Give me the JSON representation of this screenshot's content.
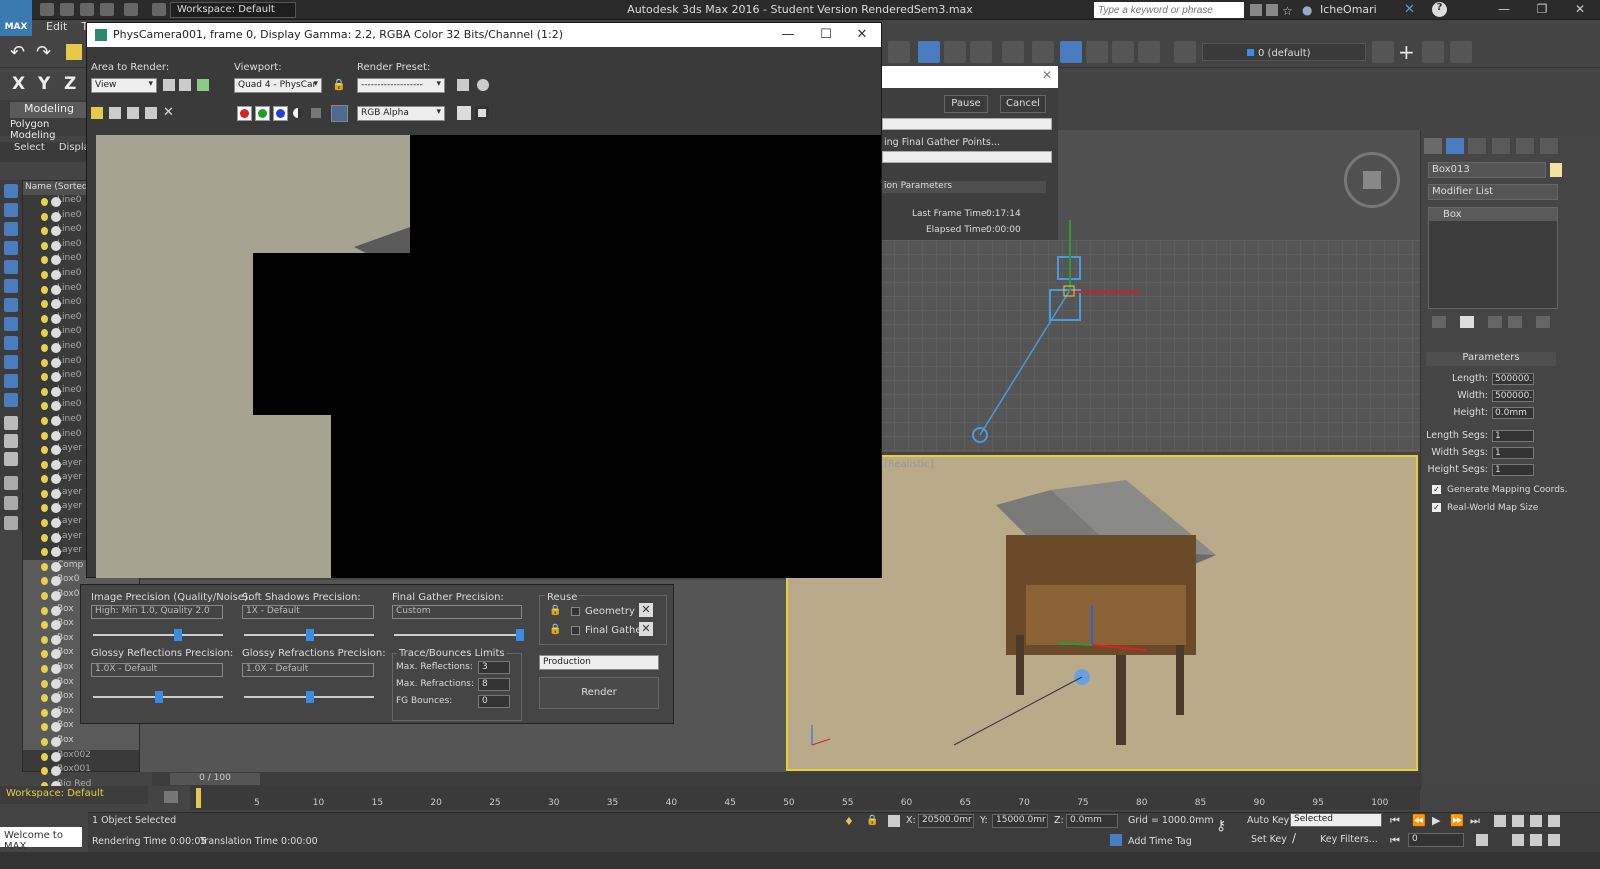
{
  "titlebar": {
    "workspace": "Workspace: Default",
    "app_title": "Autodesk 3ds Max 2016 - Student Version      RenderedSem3.max",
    "search_placeholder": "Type a keyword or phrase",
    "user": "IcheOmari"
  },
  "menubar": {
    "edit": "Edit",
    "t": "T"
  },
  "axes": [
    "X",
    "Y",
    "Z"
  ],
  "ribbon": {
    "tab": "Modeling",
    "sub": "Polygon Modeling"
  },
  "scene_tabs": [
    "Select",
    "Display"
  ],
  "explorer": {
    "header": "Name (Sorted D",
    "rows": [
      "Line0",
      "Line0",
      "Line0",
      "Line0",
      "Line0",
      "Line0",
      "Line0",
      "Line0",
      "Line0",
      "Line0",
      "Line0",
      "Line0",
      "Line0",
      "Line0",
      "Line0",
      "Line0",
      "Line0",
      "Layer",
      "Layer",
      "Layer",
      "Layer",
      "Layer",
      "Layer",
      "Layer",
      "Layer",
      "Comp",
      "Box0",
      "Box0",
      "Box",
      "Box",
      "Box",
      "Box",
      "Box",
      "Box",
      "Box",
      "Box",
      "Box",
      "Box",
      "Box002",
      "Box001",
      "Big Red"
    ]
  },
  "workspace_bottom": "Workspace: Default",
  "welcome": "Welcome to MAX",
  "vfb": {
    "title": "PhysCamera001, frame 0, Display Gamma: 2.2, RGBA Color 32 Bits/Channel (1:2)",
    "area_label": "Area to Render:",
    "area_value": "View",
    "viewport_label": "Viewport:",
    "viewport_value": "Quad 4 - PhysCar",
    "preset_label": "Render Preset:",
    "preset_value": "-------------------",
    "channel": "RGB Alpha"
  },
  "vfb_bottom": {
    "image_precision_label": "Image Precision (Quality/Noise):",
    "image_precision_value": "High: Min 1.0, Quality 2.0",
    "soft_shadows_label": "Soft Shadows Precision:",
    "soft_shadows_value": "1X - Default",
    "final_gather_label": "Final Gather Precision:",
    "final_gather_value": "Custom",
    "reuse_label": "Reuse",
    "geometry": "Geometry",
    "final_gather": "Final Gather",
    "glossy_refl_label": "Glossy Reflections Precision:",
    "glossy_refl_value": "1.0X - Default",
    "glossy_refr_label": "Glossy Refractions Precision:",
    "glossy_refr_value": "1.0X - Default",
    "trace_label": "Trace/Bounces Limits",
    "max_refl_label": "Max. Reflections:",
    "max_refl": "3",
    "max_refr_label": "Max. Refractions:",
    "max_refr": "8",
    "fg_bounces_label": "FG Bounces:",
    "fg_bounces": "0",
    "mode": "Production",
    "render_button": "Render"
  },
  "progress": {
    "pause": "Pause",
    "cancel": "Cancel",
    "status": "ing Final Gather Points...",
    "section": "ion Parameters",
    "last_frame_label": "Last Frame Time:",
    "last_frame": "0:17:14",
    "elapsed_label": "Elapsed Time:",
    "elapsed": "0:00:00"
  },
  "viewport": {
    "persp_label": "[Realistic]"
  },
  "layer": "0 (default)",
  "cmdpanel": {
    "object_name": "Box013",
    "modifier_list": "Modifier List",
    "stack_item": "Box",
    "params_head": "Parameters",
    "length_label": "Length:",
    "length": "500000.0",
    "width_label": "Width:",
    "width": "500000.0",
    "height_label": "Height:",
    "height": "0.0mm",
    "length_segs_label": "Length Segs:",
    "length_segs": "1",
    "width_segs_label": "Width Segs:",
    "width_segs": "1",
    "height_segs_label": "Height Segs:",
    "height_segs": "1",
    "gen_mapping": "Generate Mapping Coords.",
    "real_world": "Real-World Map Size"
  },
  "timeline": {
    "counter": "0 / 100",
    "labels": [
      "5",
      "10",
      "15",
      "20",
      "25",
      "30",
      "35",
      "40",
      "45",
      "50",
      "55",
      "60",
      "65",
      "70",
      "75",
      "80",
      "85",
      "90",
      "95",
      "100"
    ]
  },
  "status": {
    "selected": "1 Object Selected",
    "rendering_time": "Rendering Time  0:00:05",
    "translation_time": "Translation Time  0:00:00",
    "x_label": "X:",
    "x": "20500.0mr",
    "y_label": "Y:",
    "y": "15000.0mr",
    "z_label": "Z:",
    "z": "0.0mm",
    "grid": "Grid = 1000.0mm",
    "add_time_tag": "Add Time Tag",
    "auto_key": "Auto Key",
    "set_key": "Set Key",
    "selected_mode": "Selected",
    "key_filters": "Key Filters...",
    "frame": "0"
  }
}
